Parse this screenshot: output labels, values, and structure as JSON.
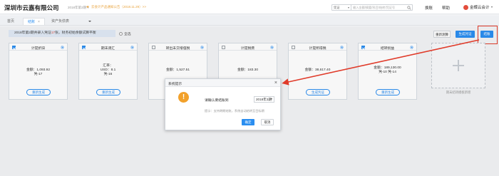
{
  "header": {
    "company": "深圳市云嘉有限公司",
    "period": "2018年第3期 ▾",
    "notice": "云会计产品通知公告（2018.11.29）>>",
    "search": {
      "type_label": "凭证",
      "placeholder": "输入金额/摘要/科目/结转/凭证号"
    },
    "links": {
      "switch": "换账",
      "help": "帮助"
    },
    "user": "金蝶云会计"
  },
  "tabs": [
    {
      "label": "首页"
    },
    {
      "label": "结账",
      "close": "×"
    },
    {
      "label": "资产负债表"
    }
  ],
  "info": {
    "prefix": "2018年第2期共录入凭证",
    "count": "17",
    "suffix": "张，财务初始余额试算平衡"
  },
  "toggle_label": "全选",
  "actions": {
    "reset": "重新测算",
    "generate": "生成凭证",
    "close": "结账"
  },
  "cards": [
    {
      "title": "计提折旧",
      "checked": true,
      "lines": [
        "金额：1,093.92",
        "凭-17"
      ],
      "button": "重新生成"
    },
    {
      "title": "期末调汇",
      "checked": true,
      "lines": [
        "汇率：",
        "USD：8.1",
        "凭-16"
      ],
      "button": "重新生成"
    },
    {
      "title": "转出未交增值税",
      "checked": false,
      "lines": [
        "金额：1,527.51"
      ],
      "button": "重新生成"
    },
    {
      "title": "计提税费",
      "checked": false,
      "lines": [
        "金额：183.30"
      ],
      "button": "重新生成"
    },
    {
      "title": "计提所得税",
      "checked": false,
      "lines": [
        "金额：38,617.40"
      ],
      "button": "生成凭证"
    },
    {
      "title": "结转损益",
      "checked": true,
      "lines": [
        "金额：189,130.00",
        "凭-10  凭-14"
      ],
      "button": "重新生成"
    }
  ],
  "add_card_label": "期末结转模板新增",
  "dialog": {
    "title": "系统提示",
    "close": "×",
    "question": "请确认要结账到",
    "selected_period": "2018年3期",
    "hint": "提示：支持跨期结账，系统自动结转至目标期",
    "ok": "确定",
    "cancel": "取消"
  },
  "colors": {
    "accent": "#2b8ef0",
    "highlight": "#e03b2a",
    "warning": "#f2a12b"
  }
}
